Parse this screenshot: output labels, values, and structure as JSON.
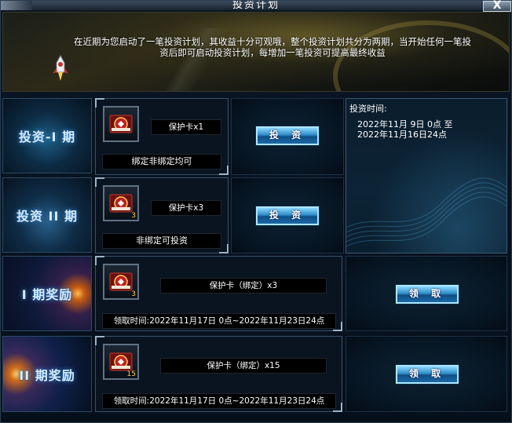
{
  "window": {
    "title": "投资计划",
    "close_label": "X"
  },
  "banner": {
    "description": "在近期为您启动了一笔投资计划，其收益十分可观哦，整个投资计划共分为两期，当开始任何一笔投资后即可启动投资计划，每增加一笔投资可提高最终收益"
  },
  "sections": [
    {
      "label": "投资-I 期"
    },
    {
      "label": "投资 II 期"
    },
    {
      "label": "I 期奖励"
    },
    {
      "label": "II 期奖励"
    }
  ],
  "rows": [
    {
      "item_name": "保护卡x1",
      "qty": "",
      "note": "绑定非绑定均可",
      "button": "投 资"
    },
    {
      "item_name": "保护卡x3",
      "qty": "3",
      "note": "非绑定可投资",
      "button": "投 资"
    },
    {
      "item_name": "保护卡（绑定）x3",
      "qty": "3",
      "note": "领取时间:2022年11月17日 0点~2022年11月23日24点",
      "button": "领 取"
    },
    {
      "item_name": "保护卡（绑定）x15",
      "qty": "15",
      "note": "领取时间:2022年11月17日 0点~2022年11月23日24点",
      "button": "领 取"
    }
  ],
  "invest_time": {
    "label": "投资时间:",
    "line1": "2022年11月 9日 0点 至",
    "line2": "2022年11月16日24点"
  },
  "colors": {
    "accent": "#2f8cc8",
    "qty": "#ffd24a",
    "background": "#050a14"
  }
}
